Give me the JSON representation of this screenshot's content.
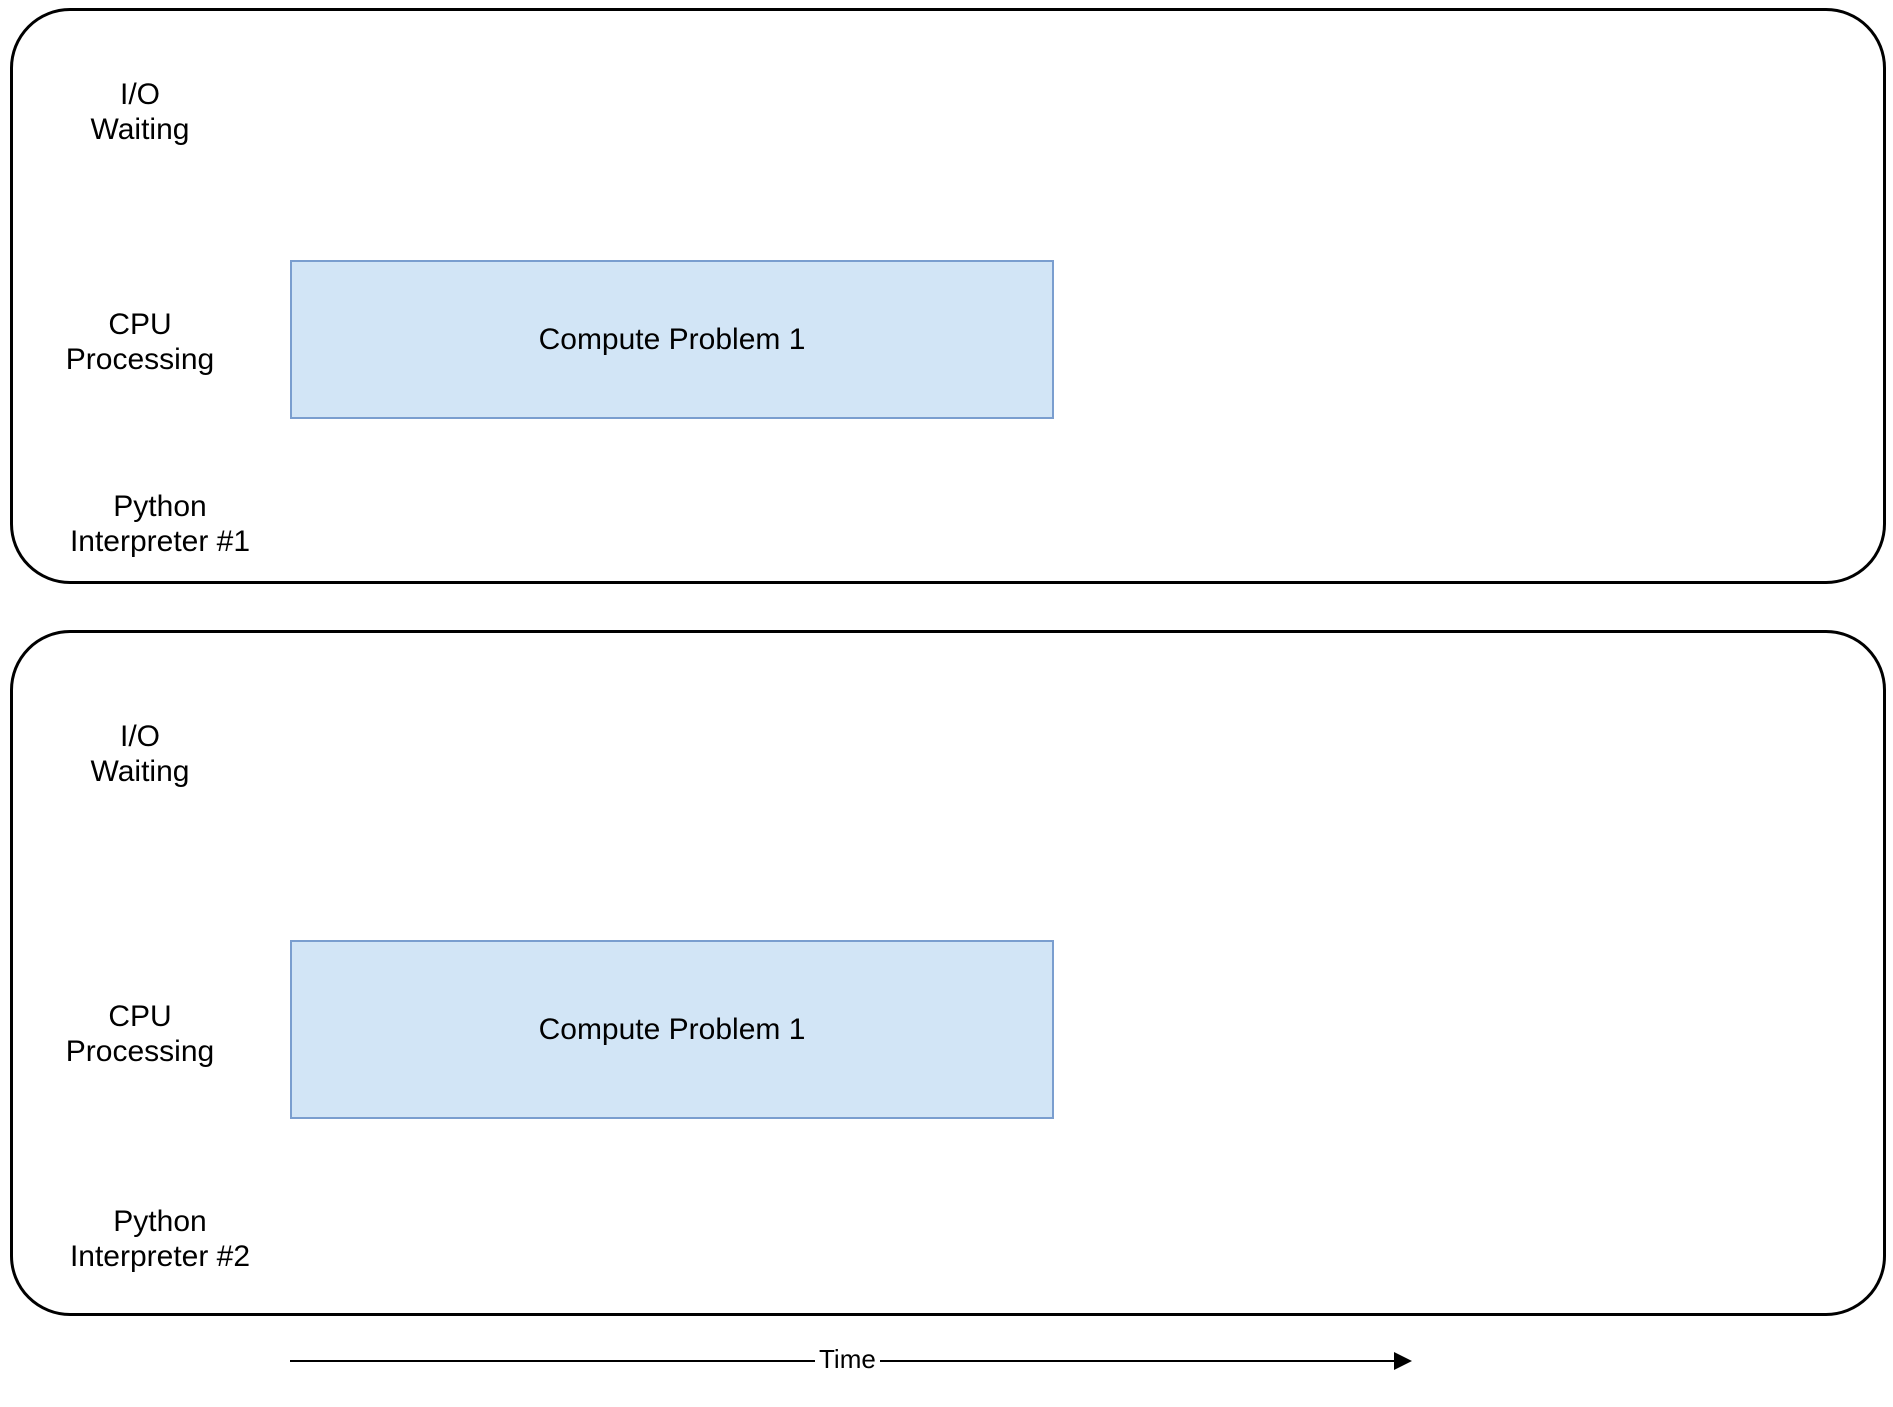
{
  "labels": {
    "io_waiting": "I/O\nWaiting",
    "cpu_processing": "CPU\nProcessing",
    "interpreter1": "Python\nInterpreter #1",
    "interpreter2": "Python\nInterpreter #2",
    "task": "Compute Problem 1",
    "time": "Time"
  },
  "colors": {
    "task_fill": "#d2e5f6",
    "task_border": "#7a9ecf",
    "panel_border": "#000000"
  },
  "chart_data": {
    "type": "table",
    "description": "Two independent Python interpreters each run a CPU-bound task in parallel along a shared time axis.",
    "rows_per_panel": [
      "I/O Waiting",
      "CPU Processing"
    ],
    "time_axis": {
      "start": 0,
      "end": 100,
      "units": "relative"
    },
    "panels": [
      {
        "name": "Python Interpreter #1",
        "tasks": [
          {
            "row": "CPU Processing",
            "label": "Compute Problem 1",
            "start": 3,
            "end": 57
          }
        ]
      },
      {
        "name": "Python Interpreter #2",
        "tasks": [
          {
            "row": "CPU Processing",
            "label": "Compute Problem 1",
            "start": 3,
            "end": 57
          }
        ]
      }
    ]
  }
}
